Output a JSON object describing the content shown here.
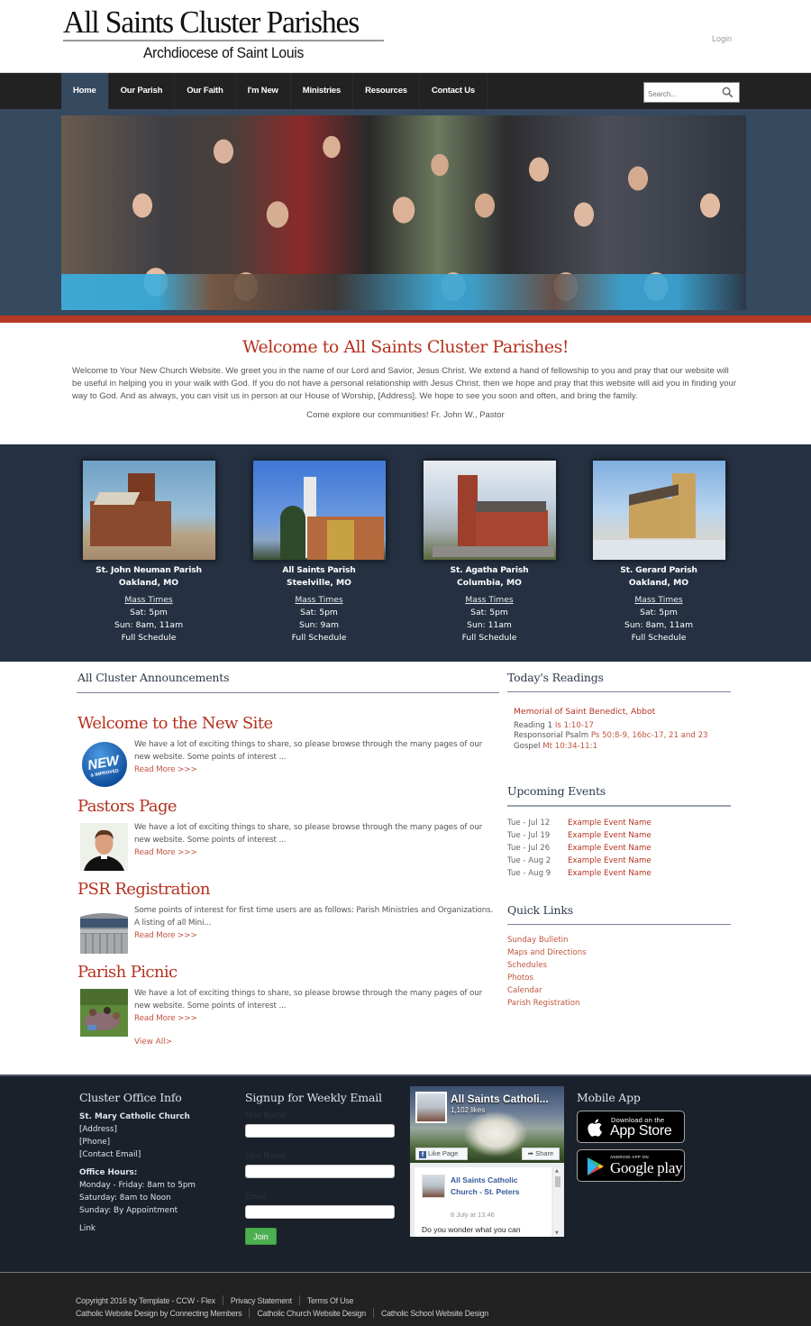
{
  "header": {
    "site_title": "All Saints Cluster Parishes",
    "site_subtitle": "Archdiocese of Saint Louis",
    "login_label": "Login"
  },
  "nav": {
    "items": [
      {
        "label": "Home",
        "active": true
      },
      {
        "label": "Our Parish"
      },
      {
        "label": "Our Faith"
      },
      {
        "label": "I'm New"
      },
      {
        "label": "Ministries"
      },
      {
        "label": "Resources"
      },
      {
        "label": "Contact Us"
      }
    ],
    "search_placeholder": "Search...",
    "search_icon": "search-icon"
  },
  "hero": {
    "image_alt": "Group photo of youth parishioners"
  },
  "welcome": {
    "title": "Welcome to All Saints Cluster Parishes!",
    "body": "Welcome to Your New Church Website. We greet you in the name of our Lord and Savior, Jesus Christ. We extend a hand of fellowship to you and pray that our website will be useful in helping you in your walk with God.  If you do not have a personal relationship with Jesus Christ, then we hope and pray that this website will aid you in finding your way to God.  And as always, you can visit us in person at our House of Worship, [Address].  We hope to see you soon and often, and bring the family.",
    "closing": "Come explore our communities! Fr. John W., Pastor"
  },
  "parishes": [
    {
      "name": "St. John Neuman Parish",
      "location": "Oakland, MO",
      "mass_label": "Mass Times",
      "sat": "Sat: 5pm",
      "sun": "Sun: 8am, 11am",
      "schedule_label": "Full Schedule"
    },
    {
      "name": "All Saints Parish",
      "location": "Steelville, MO",
      "mass_label": "Mass Times",
      "sat": "Sat: 5pm",
      "sun": "Sun: 9am",
      "schedule_label": "Full Schedule"
    },
    {
      "name": "St. Agatha Parish",
      "location": "Columbia, MO",
      "mass_label": "Mass Times",
      "sat": "Sat: 5pm",
      "sun": "Sun: 11am",
      "schedule_label": "Full Schedule"
    },
    {
      "name": "St. Gerard Parish",
      "location": "Oakland, MO",
      "mass_label": "Mass Times",
      "sat": "Sat: 5pm",
      "sun": "Sun: 8am, 11am",
      "schedule_label": "Full Schedule"
    }
  ],
  "announcements": {
    "heading": "All Cluster Announcements",
    "items": [
      {
        "title": "Welcome to the New Site",
        "excerpt": "We have a lot of exciting things to share, so please browse through the many pages of our new website. Some points of interest ...",
        "read_more": "Read More >>>",
        "thumb": "new-improved-badge"
      },
      {
        "title": "Pastors Page",
        "excerpt": "We have a lot of exciting things to share, so please browse through the many pages of our new website. Some points of interest ...",
        "read_more": "Read More >>>",
        "thumb": "pastor-portrait"
      },
      {
        "title": "PSR Registration",
        "excerpt": "Some points of interest for first time users are as follows: Parish Ministries and Organizations. A listing of all Mini...",
        "read_more": "Read More >>>",
        "thumb": "school-building"
      },
      {
        "title": "Parish Picnic",
        "excerpt": "We have a lot of exciting things to share, so please browse through the many pages of our new website. Some points of interest ...",
        "read_more": "Read More >>>",
        "thumb": "picnic-photo"
      }
    ],
    "view_all": "View All>"
  },
  "readings": {
    "heading": "Today's Readings",
    "memorial": "Memorial of Saint Benedict, Abbot",
    "lines": [
      {
        "label": "Reading 1",
        "ref": "Is 1:10-17"
      },
      {
        "label": "Responsorial Psalm",
        "ref": "Ps 50:8-9, 16bc-17, 21 and 23"
      },
      {
        "label": "Gospel",
        "ref": "Mt 10:34-11:1"
      }
    ]
  },
  "events": {
    "heading": "Upcoming Events",
    "items": [
      {
        "date": "Tue - Jul 12",
        "name": "Example Event Name"
      },
      {
        "date": "Tue - Jul 19",
        "name": "Example Event Name"
      },
      {
        "date": "Tue - Jul 26",
        "name": "Example Event Name"
      },
      {
        "date": "Tue - Aug 2",
        "name": "Example Event Name"
      },
      {
        "date": "Tue - Aug 9",
        "name": "Example Event Name"
      }
    ]
  },
  "quick_links": {
    "heading": "Quick Links",
    "items": [
      "Sunday Bulletin",
      "Maps and Directions",
      "Schedules",
      "Photos",
      "Calendar",
      "Parish Registration"
    ]
  },
  "footer": {
    "office": {
      "heading": "Cluster Office Info",
      "church": "St. Mary Catholic Church",
      "address": "[Address]",
      "phone": "[Phone]",
      "email": "[Contact Email]",
      "hours_label": "Office Hours:",
      "hours": [
        "Monday - Friday: 8am to 5pm",
        "Saturday: 8am to Noon",
        "Sunday: By Appointment"
      ],
      "link": "Link"
    },
    "signup": {
      "heading": "Signup for Weekly Email",
      "first_name_label": "First Name",
      "first_name_value": "",
      "last_name_label": "Last Name",
      "last_name_value": "",
      "email_label": "Email",
      "email_value": "",
      "join_label": "Join"
    },
    "facebook": {
      "page_name": "All Saints Catholi...",
      "likes": "1,102 likes",
      "like_label": "Like Page",
      "share_label": "Share",
      "post_author": "All Saints Catholic Church - St. Peters",
      "post_date": "8 July at 13:46",
      "post_text": "Do you wonder what you can"
    },
    "mobile": {
      "heading": "Mobile App",
      "appstore_small": "Download on the",
      "appstore_big": "App Store",
      "google_small": "ANDROID APP ON",
      "google_big": "Google play"
    }
  },
  "bottom": {
    "line1": [
      "Copyright 2016 by Template - CCW - Flex",
      "Privacy Statement",
      "Terms Of Use"
    ],
    "line2": [
      "Catholic Website Design by Connecting Members",
      "Catholic Church Website Design",
      "Catholic School Website Design"
    ]
  },
  "colors": {
    "accent_red": "#b5321f",
    "nav_bg": "#222222",
    "nav_active": "#35495f",
    "parish_band": "#253142",
    "footer_bg": "#1b212b",
    "join_green": "#4caf50"
  }
}
